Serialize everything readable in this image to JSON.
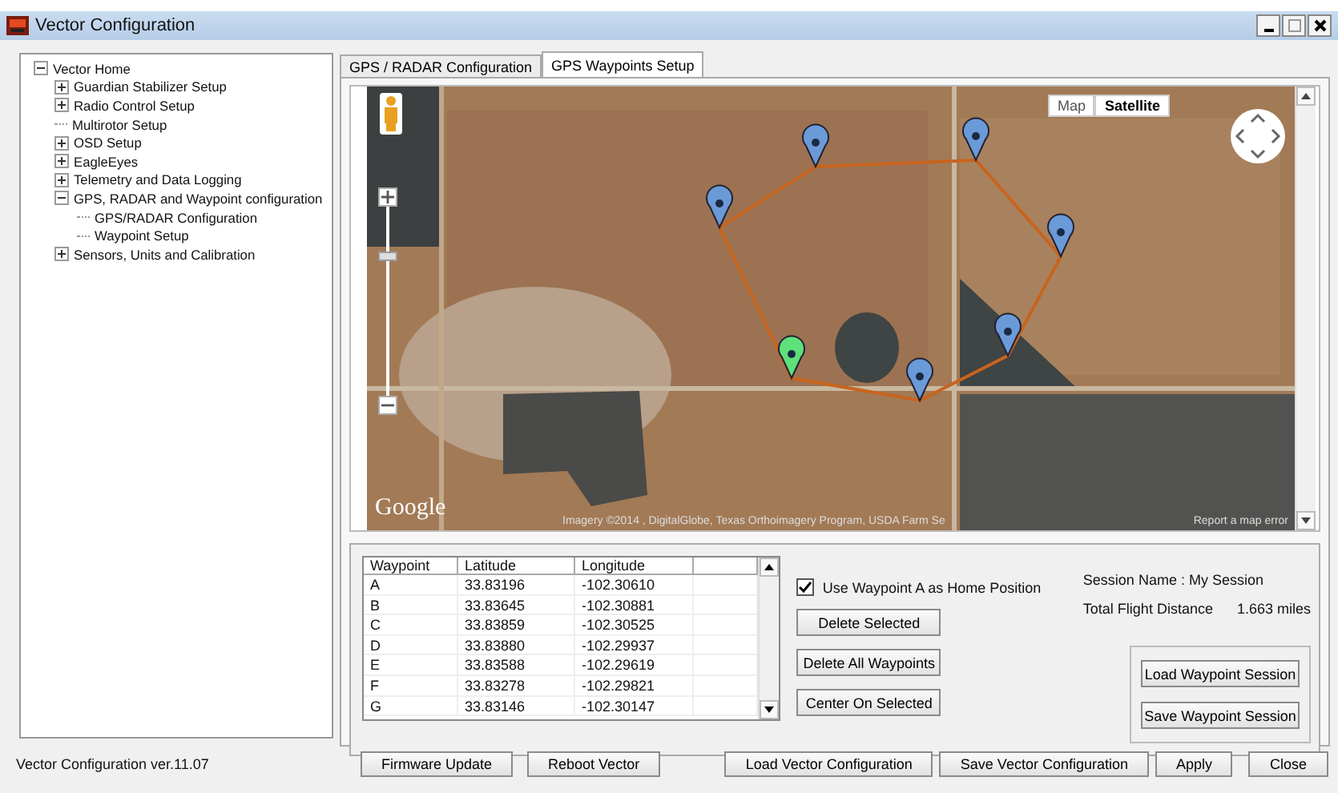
{
  "window": {
    "title": "Vector Configuration"
  },
  "tree": [
    {
      "label": "Vector Home",
      "expanded": true,
      "children": [
        {
          "label": "Guardian Stabilizer Setup",
          "expanded": false
        },
        {
          "label": "Radio Control Setup",
          "expanded": false
        },
        {
          "label": "Multirotor Setup"
        },
        {
          "label": "OSD Setup",
          "expanded": false
        },
        {
          "label": "EagleEyes",
          "expanded": false
        },
        {
          "label": "Telemetry and Data Logging",
          "expanded": false
        },
        {
          "label": "GPS, RADAR and Waypoint configuration",
          "expanded": true,
          "children": [
            {
              "label": "GPS/RADAR Configuration"
            },
            {
              "label": "Waypoint Setup"
            }
          ]
        },
        {
          "label": "Sensors, Units and Calibration",
          "expanded": false
        }
      ]
    }
  ],
  "tabs": [
    {
      "label": "GPS / RADAR Configuration",
      "selected": false
    },
    {
      "label": "GPS Waypoints Setup",
      "selected": true
    }
  ],
  "map": {
    "zoom": {
      "level": 0.75
    },
    "types": [
      {
        "label": "Map",
        "selected": false
      },
      {
        "label": "Satellite",
        "selected": true
      }
    ],
    "logo": "Google",
    "attribution": "Imagery ©2014 , DigitalGlobe, Texas Orthoimagery Program, USDA Farm Se",
    "report": "Report a map error"
  },
  "table": {
    "columns": [
      "Waypoint",
      "Latitude",
      "Longitude"
    ],
    "rows": [
      [
        "A",
        "33.83196",
        "-102.30610"
      ],
      [
        "B",
        "33.83645",
        "-102.30881"
      ],
      [
        "C",
        "33.83859",
        "-102.30525"
      ],
      [
        "D",
        "33.83880",
        "-102.29937"
      ],
      [
        "E",
        "33.83588",
        "-102.29619"
      ],
      [
        "F",
        "33.83278",
        "-102.29821"
      ],
      [
        "G",
        "33.83146",
        "-102.30147"
      ]
    ]
  },
  "home_checkbox": {
    "label": "Use Waypoint A as Home Position",
    "checked": true
  },
  "waypoint_buttons": [
    "Delete Selected",
    "Delete All Waypoints",
    "Center On Selected"
  ],
  "session": {
    "name": "Session Name : My Session",
    "distance_label": "Total Flight Distance",
    "distance": "1.663 miles"
  },
  "session_buttons": [
    "Load Waypoint Session",
    "Save Waypoint Session"
  ],
  "status": "Vector Configuration ver.11.07",
  "bottom_buttons_left": [
    "Firmware Update",
    "Reboot Vector"
  ],
  "bottom_buttons_right": [
    "Load Vector Configuration",
    "Save Vector Configuration",
    "Apply",
    "Close"
  ]
}
